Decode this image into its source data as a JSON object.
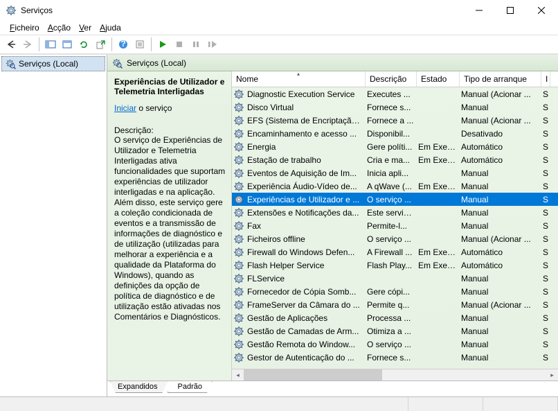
{
  "window": {
    "title": "Serviços"
  },
  "menu": {
    "file": "Ficheiro",
    "action": "Acção",
    "view": "Ver",
    "help": "Ajuda"
  },
  "left": {
    "node": "Serviços (Local)"
  },
  "header": {
    "title": "Serviços (Local)"
  },
  "desc": {
    "title": "Experiências de Utilizador e Telemetria Interligadas",
    "link": "Iniciar",
    "link_after": " o serviço",
    "label": "Descrição:",
    "text": "O serviço de Experiências de Utilizador e Telemetria Interligadas ativa funcionalidades que suportam experiências de utilizador interligadas e na aplicação. Além disso, este serviço gere a coleção condicionada de eventos e a transmissão de informações de diagnóstico e de utilização (utilizadas para melhorar a experiência e a qualidade da Plataforma do Windows), quando as definições da opção de política de diagnóstico e de utilização estão ativadas nos Comentários e Diagnósticos."
  },
  "columns": {
    "name": "Nome",
    "desc": "Descrição",
    "state": "Estado",
    "type": "Tipo de arranque",
    "last": "I"
  },
  "rows": [
    {
      "name": "Diagnostic Execution Service",
      "desc": "Executes ...",
      "state": "",
      "type": "Manual (Acionar ...",
      "last": "S"
    },
    {
      "name": "Disco Virtual",
      "desc": "Fornece s...",
      "state": "",
      "type": "Manual",
      "last": "S"
    },
    {
      "name": "EFS (Sistema de Encriptação...",
      "desc": "Fornece a ...",
      "state": "",
      "type": "Manual (Acionar ...",
      "last": "S"
    },
    {
      "name": "Encaminhamento e acesso ...",
      "desc": "Disponibil...",
      "state": "",
      "type": "Desativado",
      "last": "S"
    },
    {
      "name": "Energia",
      "desc": "Gere políti...",
      "state": "Em Exec...",
      "type": "Automático",
      "last": "S"
    },
    {
      "name": "Estação de trabalho",
      "desc": "Cria e ma...",
      "state": "Em Exec...",
      "type": "Automático",
      "last": "S"
    },
    {
      "name": "Eventos de Aquisição de Im...",
      "desc": "Inicia apli...",
      "state": "",
      "type": "Manual",
      "last": "S"
    },
    {
      "name": "Experiência Áudio-Vídeo de...",
      "desc": "A qWave (...",
      "state": "Em Exec...",
      "type": "Manual",
      "last": "S"
    },
    {
      "name": "Experiências de Utilizador e ...",
      "desc": "O serviço ...",
      "state": "",
      "type": "Manual",
      "last": "S",
      "selected": true
    },
    {
      "name": "Extensões e Notificações da...",
      "desc": "Este serviç...",
      "state": "",
      "type": "Manual",
      "last": "S"
    },
    {
      "name": "Fax",
      "desc": "Permite-l...",
      "state": "",
      "type": "Manual",
      "last": "S"
    },
    {
      "name": "Ficheiros offline",
      "desc": "O serviço ...",
      "state": "",
      "type": "Manual (Acionar ...",
      "last": "S"
    },
    {
      "name": "Firewall do Windows Defen...",
      "desc": "A Firewall ...",
      "state": "Em Exec...",
      "type": "Automático",
      "last": "S"
    },
    {
      "name": "Flash Helper Service",
      "desc": "Flash Play...",
      "state": "Em Exec...",
      "type": "Automático",
      "last": "S"
    },
    {
      "name": "FLService",
      "desc": "",
      "state": "",
      "type": "Manual",
      "last": "S"
    },
    {
      "name": "Fornecedor de Cópia Somb...",
      "desc": "Gere cópi...",
      "state": "",
      "type": "Manual",
      "last": "S"
    },
    {
      "name": "FrameServer da Câmara do ...",
      "desc": "Permite q...",
      "state": "",
      "type": "Manual (Acionar ...",
      "last": "S"
    },
    {
      "name": "Gestão de Aplicações",
      "desc": "Processa ...",
      "state": "",
      "type": "Manual",
      "last": "S"
    },
    {
      "name": "Gestão de Camadas de Arm...",
      "desc": "Otimiza a ...",
      "state": "",
      "type": "Manual",
      "last": "S"
    },
    {
      "name": "Gestão Remota do Window...",
      "desc": "O serviço ...",
      "state": "",
      "type": "Manual",
      "last": "S"
    },
    {
      "name": "Gestor de Autenticação do ...",
      "desc": "Fornece s...",
      "state": "",
      "type": "Manual",
      "last": "S"
    }
  ],
  "tabs": {
    "t1": "Expandidos",
    "t2": "Padrão"
  }
}
